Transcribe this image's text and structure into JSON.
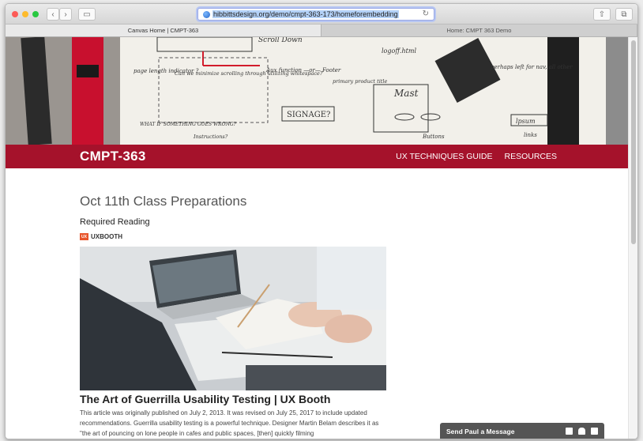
{
  "browser": {
    "url": "hibbittsdesign.org/demo/cmpt-363-173/homeforembedding",
    "tabs": [
      {
        "label": "Canvas Home | CMPT-363",
        "active": true
      },
      {
        "label": "Home: CMPT 363 Demo",
        "active": false
      }
    ],
    "back_glyph": "‹",
    "forward_glyph": "›",
    "sidebar_glyph": "▭",
    "reload_glyph": "↻",
    "share_glyph": "⇧",
    "tabs_glyph": "⧉",
    "new_tab_glyph": "+"
  },
  "hero": {
    "notes": [
      "Scroll Down",
      "page length indicator ?",
      "Can we minimize scrolling through utilizing whitespace?",
      "Aux function —or— Footer",
      "primary product title",
      "SIGNAGE?",
      "WHAT IF SOMETHING GOES WRONG?",
      "Instructions?",
      "logoff.html",
      "Mast",
      "Buttons",
      "perhaps left for nav, all other",
      "lpsum",
      "links"
    ]
  },
  "site": {
    "brand": "CMPT-363",
    "nav": [
      "UX TECHNIQUES GUIDE",
      "RESOURCES"
    ],
    "accent": "#a5122b"
  },
  "main": {
    "title": "Oct 11th Class Preparations",
    "section": "Required Reading",
    "source_logo": "UX",
    "source": "UXBOOTH",
    "article_title": "The Art of Guerrilla Usability Testing | UX Booth",
    "article_body": "This article was originally published on July 2, 2013. It was revised on July 25, 2017 to include updated recommendations. Guerrilla usability testing is a powerful technique. Designer Martin Belam describes it as \"the art of pouncing on lone people in cafes and public spaces, [then] quickly filming"
  },
  "chat": {
    "label": "Send Paul a Message"
  }
}
